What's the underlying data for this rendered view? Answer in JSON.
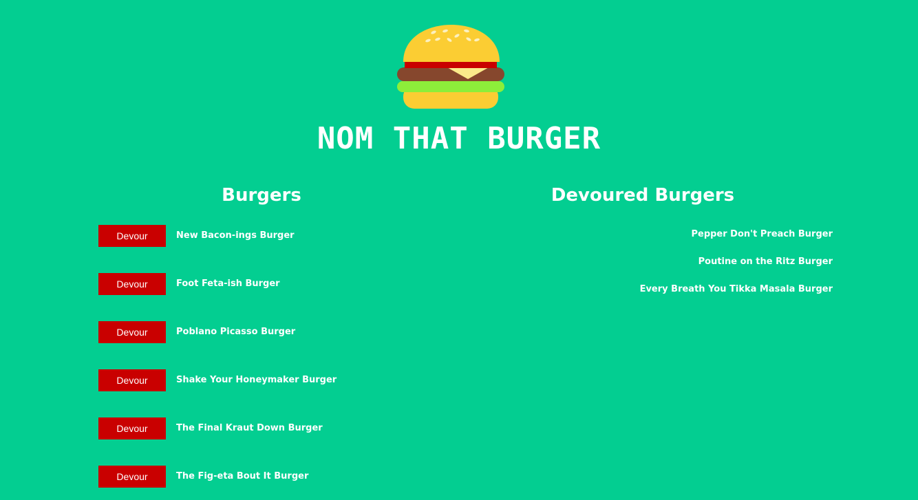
{
  "theme": {
    "background": "#03ce91",
    "button_bg": "#c90000",
    "text": "#ffffff"
  },
  "header": {
    "logo_icon": "burger-icon",
    "title": "Nom That Burger"
  },
  "burgers": {
    "heading": "Burgers",
    "button_label": "Devour",
    "items": [
      {
        "name": "New Bacon-ings Burger"
      },
      {
        "name": "Foot Feta-ish Burger"
      },
      {
        "name": "Poblano Picasso Burger"
      },
      {
        "name": "Shake Your Honeymaker Burger"
      },
      {
        "name": "The Final Kraut Down Burger"
      },
      {
        "name": "The Fig-eta Bout It Burger"
      }
    ]
  },
  "devoured": {
    "heading": "Devoured Burgers",
    "items": [
      {
        "name": "Pepper Don't Preach Burger"
      },
      {
        "name": "Poutine on the Ritz Burger"
      },
      {
        "name": "Every Breath You Tikka Masala Burger"
      }
    ]
  }
}
